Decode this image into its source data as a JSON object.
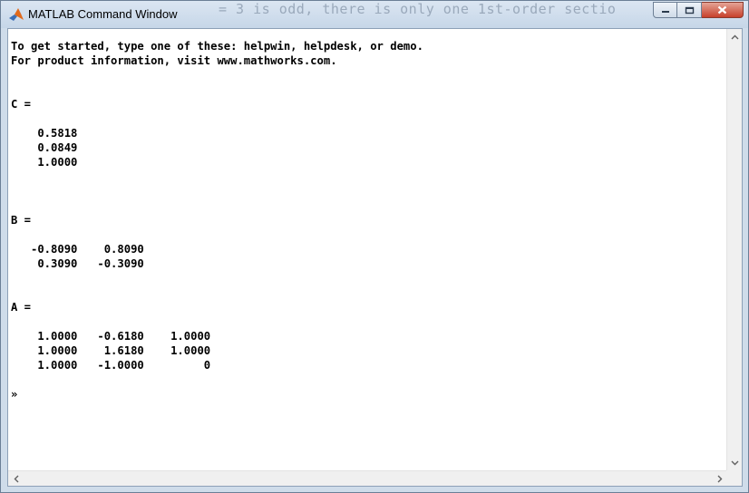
{
  "window": {
    "title": "MATLAB Command Window",
    "background_text": "= 3 is odd, there is only one 1st-order sectio"
  },
  "console": {
    "lines": [
      "To get started, type one of these: helpwin, helpdesk, or demo.",
      "For product information, visit www.mathworks.com.",
      "",
      "",
      "C =",
      "",
      "    0.5818",
      "    0.0849",
      "    1.0000",
      "",
      "",
      "",
      "B =",
      "",
      "   -0.8090    0.8090",
      "    0.3090   -0.3090",
      "",
      "",
      "A =",
      "",
      "    1.0000   -0.6180    1.0000",
      "    1.0000    1.6180    1.0000",
      "    1.0000   -1.0000         0",
      ""
    ],
    "prompt": "»"
  },
  "colors": {
    "titlebar": "#c6d6e8",
    "close_button": "#c7402b",
    "text": "#000000"
  }
}
